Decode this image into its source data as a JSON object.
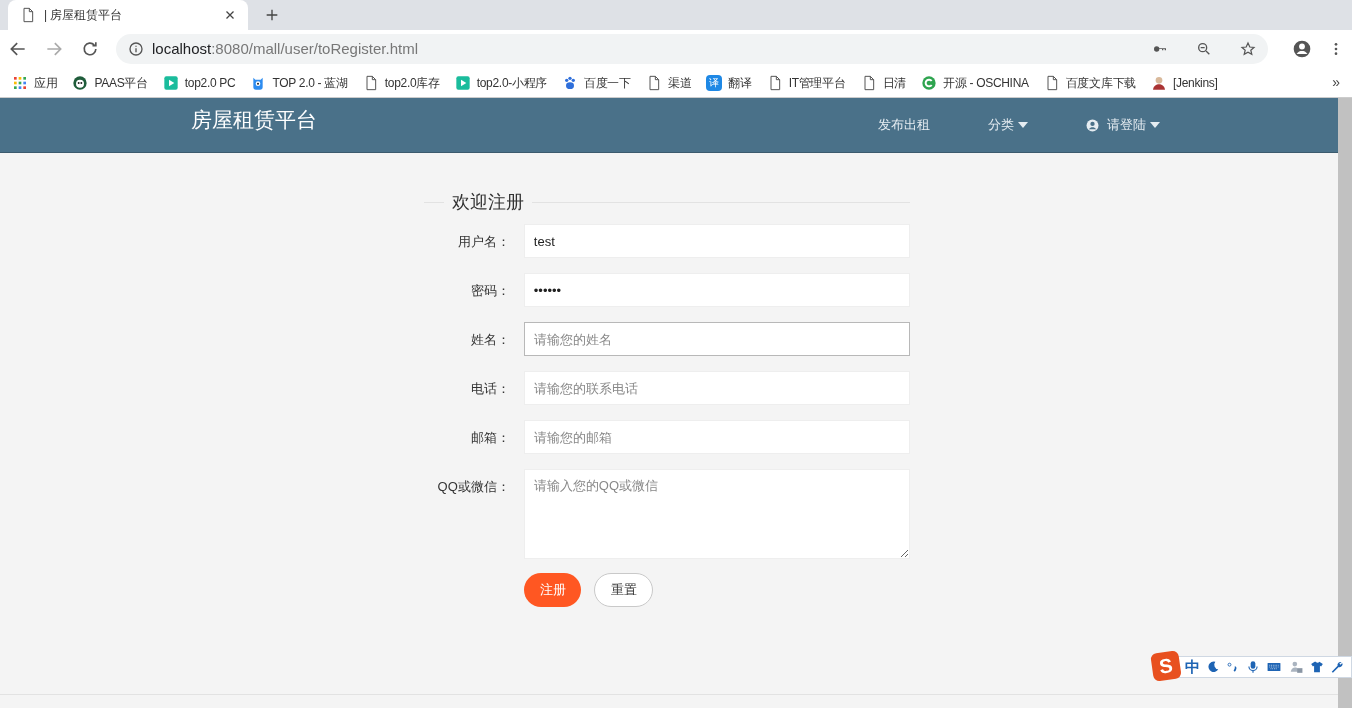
{
  "browser": {
    "tab_title": "| 房屋租赁平台",
    "url_host": "localhost",
    "url_path": ":8080/mall/user/toRegister.html",
    "bookmarks": [
      {
        "kind": "apps",
        "label": "应用"
      },
      {
        "kind": "panda",
        "label": "PAAS平台"
      },
      {
        "kind": "play",
        "label": "top2.0 PC"
      },
      {
        "kind": "monster",
        "label": "TOP 2.0 - 蓝湖"
      },
      {
        "kind": "page",
        "label": "top2.0库存"
      },
      {
        "kind": "play",
        "label": "top2.0-小程序"
      },
      {
        "kind": "paw",
        "label": "百度一下"
      },
      {
        "kind": "page",
        "label": "渠道"
      },
      {
        "kind": "translate",
        "label": "翻译",
        "glyph": "译"
      },
      {
        "kind": "page",
        "label": "IT管理平台"
      },
      {
        "kind": "page",
        "label": "日清"
      },
      {
        "kind": "oschina",
        "label": "开源 - OSCHINA"
      },
      {
        "kind": "page",
        "label": "百度文库下载"
      },
      {
        "kind": "avatar",
        "label": "[Jenkins]"
      }
    ],
    "more": "»"
  },
  "navbar": {
    "brand": "房屋租赁平台",
    "items": [
      {
        "kind": "link",
        "label": "发布出租"
      },
      {
        "kind": "dropdown",
        "label": "分类"
      },
      {
        "kind": "user",
        "label": "请登陆"
      }
    ]
  },
  "form": {
    "legend": "欢迎注册",
    "fields": [
      {
        "kind": "input",
        "label": "用户名：",
        "value": "test",
        "focused": false
      },
      {
        "kind": "input",
        "label": "密码：",
        "value": "••••••",
        "focused": false
      },
      {
        "kind": "input",
        "label": "姓名：",
        "placeholder": "请输您的姓名",
        "focused": true
      },
      {
        "kind": "input",
        "label": "电话：",
        "placeholder": "请输您的联系电话",
        "focused": false
      },
      {
        "kind": "input",
        "label": "邮箱：",
        "placeholder": "请输您的邮箱",
        "focused": false
      },
      {
        "kind": "textarea",
        "label": "QQ或微信：",
        "placeholder": "请输入您的QQ或微信",
        "focused": false
      }
    ],
    "buttons": [
      {
        "kind": "primary",
        "label": "注册"
      },
      {
        "kind": "secondary",
        "label": "重置"
      }
    ]
  },
  "ime": {
    "logo": "S",
    "mode": "中"
  }
}
